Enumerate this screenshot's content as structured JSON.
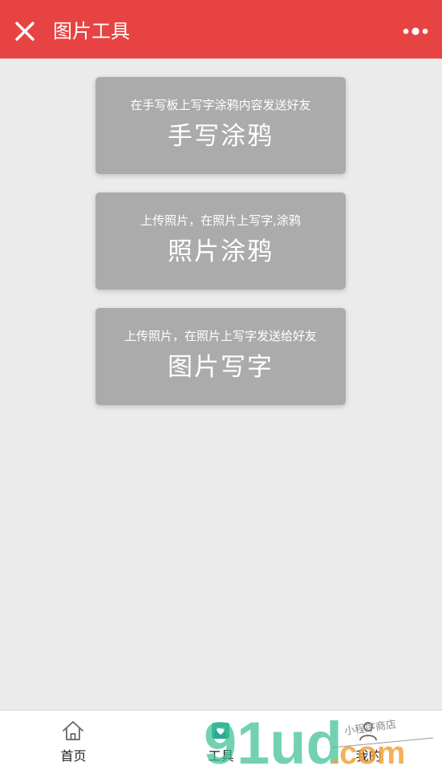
{
  "header": {
    "title": "图片工具",
    "background": "#e84343",
    "close_icon": "close-icon",
    "more_icon": "more-dots-icon"
  },
  "cards": [
    {
      "subtitle": "在手写板上写字涂鸦内容发送好友",
      "title": "手写涂鸦"
    },
    {
      "subtitle": "上传照片，在照片上写字,涂鸦",
      "title": "照片涂鸦"
    },
    {
      "subtitle": "上传照片，在照片上写字发送给好友",
      "title": "图片写字"
    }
  ],
  "tabbar": {
    "items": [
      {
        "label": "首页",
        "icon": "home-icon"
      },
      {
        "label": "工具",
        "icon": "tools-icon"
      },
      {
        "label": "我的",
        "icon": "user-icon"
      }
    ]
  },
  "watermark": {
    "text": "91ud",
    "suffix": ".com",
    "tagline": "小程序商店"
  },
  "colors": {
    "accent": "#e84343",
    "card": "#ababab",
    "background": "#ebebeb"
  }
}
